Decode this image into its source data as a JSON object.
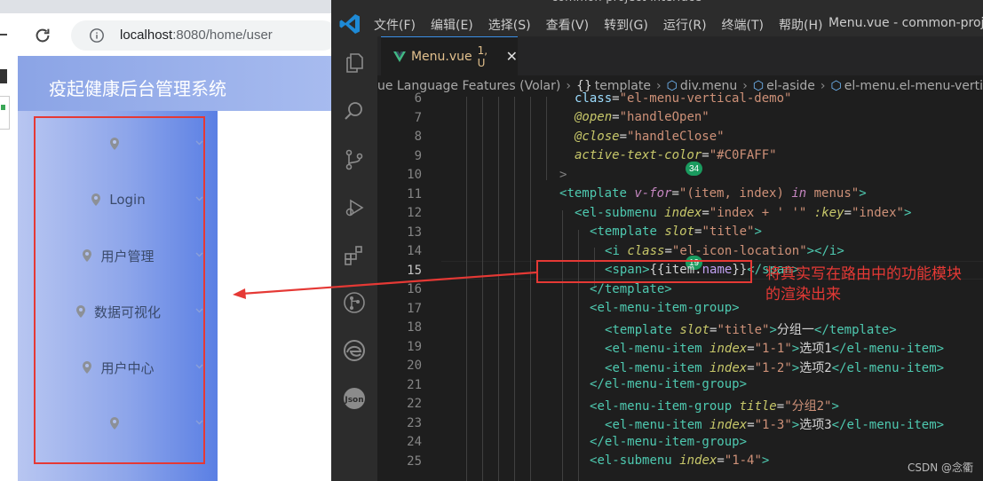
{
  "browser": {
    "url_host": "localhost",
    "url_rest": ":8080/home/user",
    "app_title": "疫起健康后台管理系统",
    "menu": [
      {
        "label": ""
      },
      {
        "label": "Login"
      },
      {
        "label": "用户管理"
      },
      {
        "label": "数据可视化"
      },
      {
        "label": "用户中心"
      },
      {
        "label": ""
      }
    ]
  },
  "vscode": {
    "ghost_title": "common-project-interface",
    "menus": [
      "文件(F)",
      "编辑(E)",
      "选择(S)",
      "查看(V)",
      "转到(G)",
      "运行(R)",
      "终端(T)",
      "帮助(H)"
    ],
    "window_title": "Menu.vue - common-project-",
    "tab": {
      "name": "Menu.vue",
      "status": "1, U",
      "close": "✕"
    },
    "badges": {
      "scm": "34",
      "extensions": "19"
    },
    "breadcrumb": [
      "ue Language Features (Volar)",
      "template",
      "div.menu",
      "el-aside",
      "el-menu.el-menu-vertical-de"
    ],
    "line_numbers": [
      "6",
      "7",
      "8",
      "9",
      "10",
      "11",
      "12",
      "13",
      "14",
      "15",
      "16",
      "17",
      "18",
      "19",
      "20",
      "21",
      "22",
      "23",
      "24",
      "25"
    ],
    "current_line": "15"
  },
  "annotation": {
    "line1": "将真实写在路由中的功能模块",
    "line2": "的渲染出来"
  },
  "watermark": "CSDN @念衢",
  "colors": {
    "accent": "#e53935",
    "sidebar_from": "#b8c6f1",
    "sidebar_to": "#5a7fe4"
  }
}
